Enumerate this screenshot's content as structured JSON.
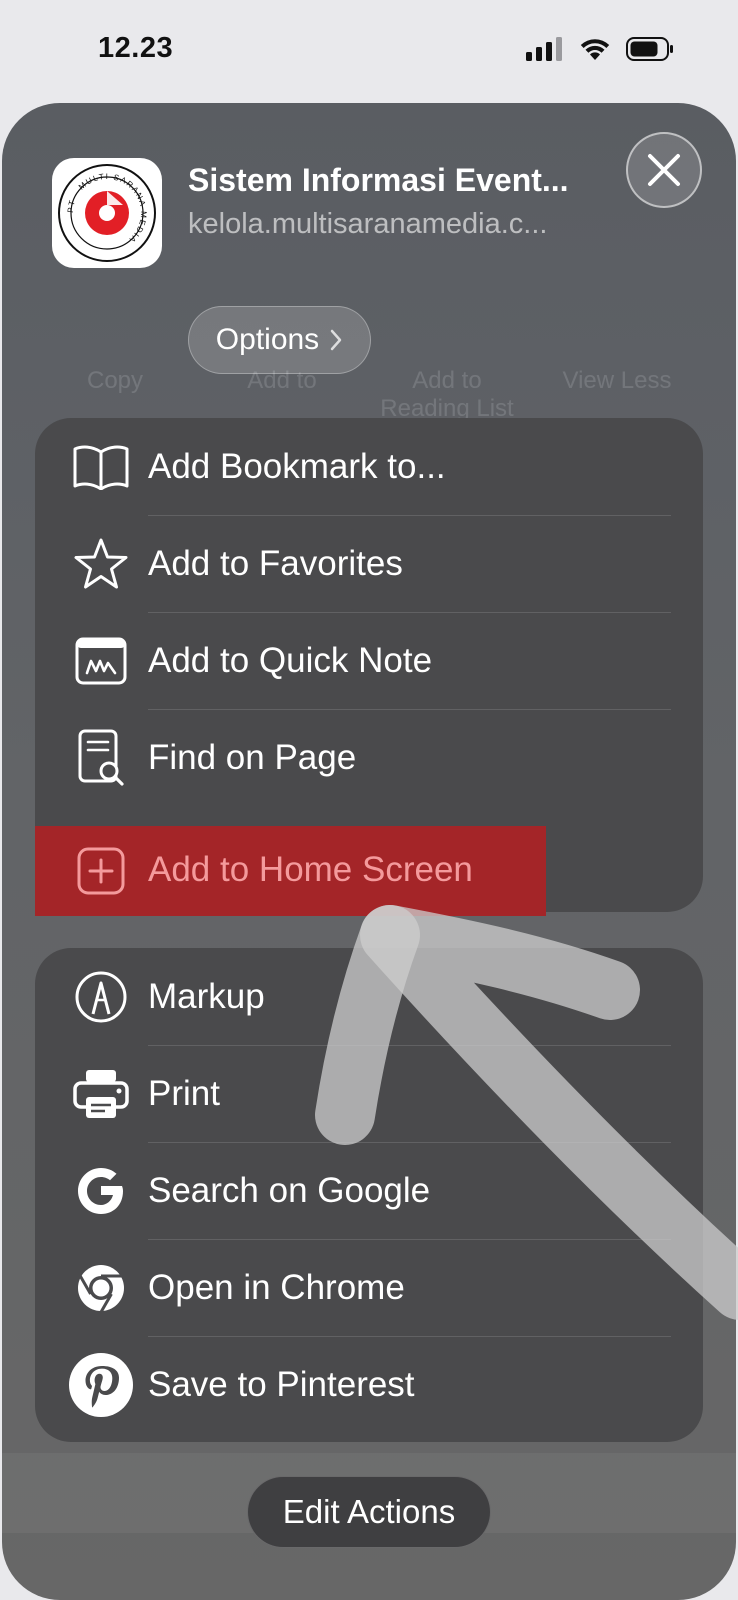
{
  "status_bar": {
    "time": "12.23"
  },
  "header": {
    "site_title": "Sistem Informasi Event...",
    "site_url": "kelola.multisaranamedia.c...",
    "options_label": "Options",
    "logo_text": "PT · MULTI SARANA MEDIA"
  },
  "background_actions": [
    "Copy",
    "Add to",
    "Add to Reading List",
    "View Less"
  ],
  "group1": {
    "items": [
      {
        "label": "Add Bookmark to...",
        "icon": "book-icon"
      },
      {
        "label": "Add to Favorites",
        "icon": "star-icon"
      },
      {
        "label": "Add to Quick Note",
        "icon": "quick-note-icon"
      },
      {
        "label": "Find on Page",
        "icon": "find-on-page-icon"
      },
      {
        "label": "Add to Home Screen",
        "icon": "add-square-icon"
      }
    ]
  },
  "group2": {
    "items": [
      {
        "label": "Markup",
        "icon": "markup-icon"
      },
      {
        "label": "Print",
        "icon": "printer-icon"
      },
      {
        "label": "Search on Google",
        "icon": "google-icon"
      },
      {
        "label": "Open in Chrome",
        "icon": "chrome-icon"
      },
      {
        "label": "Save to Pinterest",
        "icon": "pinterest-icon"
      }
    ]
  },
  "edit_actions_label": "Edit Actions",
  "colors": {
    "highlight": "#a42528",
    "highlight_text": "#f49a9c",
    "logo_red": "#e21f26",
    "group_bg": "#4a4a4c"
  }
}
